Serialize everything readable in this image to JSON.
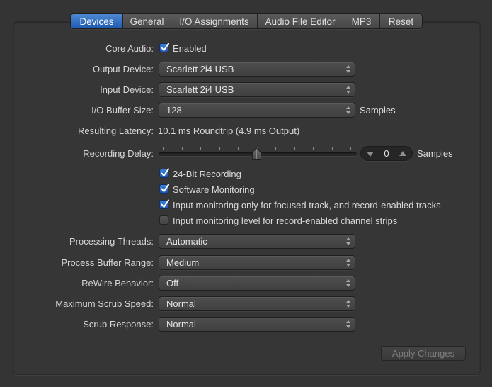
{
  "tabs": [
    {
      "label": "Devices",
      "active": true
    },
    {
      "label": "General",
      "active": false
    },
    {
      "label": "I/O Assignments",
      "active": false
    },
    {
      "label": "Audio File Editor",
      "active": false
    },
    {
      "label": "MP3",
      "active": false
    },
    {
      "label": "Reset",
      "active": false
    }
  ],
  "core_audio": {
    "label": "Core Audio:",
    "checkbox_label": "Enabled",
    "checked": true
  },
  "output_device": {
    "label": "Output Device:",
    "value": "Scarlett 2i4 USB"
  },
  "input_device": {
    "label": "Input Device:",
    "value": "Scarlett 2i4 USB"
  },
  "io_buffer": {
    "label": "I/O Buffer Size:",
    "value": "128",
    "unit": "Samples"
  },
  "latency": {
    "label": "Resulting Latency:",
    "value": "10.1 ms Roundtrip (4.9 ms Output)"
  },
  "recording_delay": {
    "label": "Recording Delay:",
    "value": "0",
    "unit": "Samples",
    "slider_position_fraction": 0.5,
    "tick_count": 11
  },
  "options": [
    {
      "label": "24-Bit Recording",
      "checked": true
    },
    {
      "label": "Software Monitoring",
      "checked": true
    },
    {
      "label": "Input monitoring only for focused track, and record-enabled tracks",
      "checked": true
    },
    {
      "label": "Input monitoring level for record-enabled channel strips",
      "checked": false
    }
  ],
  "processing_threads": {
    "label": "Processing Threads:",
    "value": "Automatic"
  },
  "process_buffer_range": {
    "label": "Process Buffer Range:",
    "value": "Medium"
  },
  "rewire_behavior": {
    "label": "ReWire Behavior:",
    "value": "Off"
  },
  "max_scrub_speed": {
    "label": "Maximum Scrub Speed:",
    "value": "Normal"
  },
  "scrub_response": {
    "label": "Scrub Response:",
    "value": "Normal"
  },
  "apply_button": {
    "label": "Apply Changes",
    "enabled": false
  },
  "colors": {
    "accent": "#2f6fc8",
    "background": "#343434",
    "disabled_text": "#7f7f7f"
  }
}
